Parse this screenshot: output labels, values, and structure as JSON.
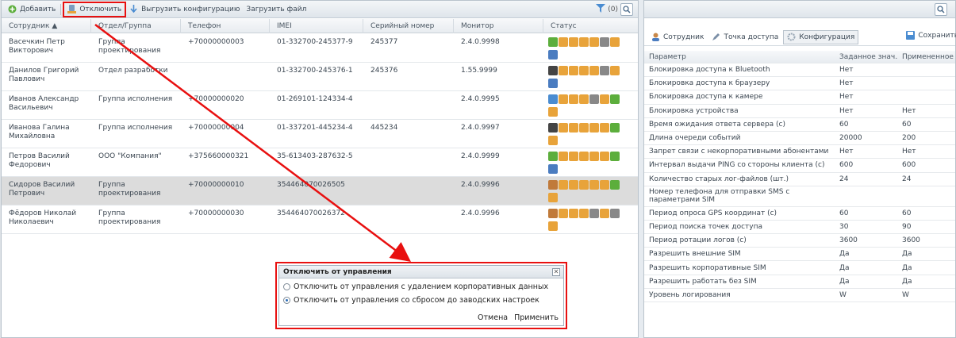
{
  "toolbar": {
    "add": "Добавить",
    "disconnect": "Отключить",
    "export": "Выгрузить конфигурацию",
    "upload": "Загрузить файл",
    "filter_count": "(0)"
  },
  "columns": [
    "Сотрудник ▲",
    "Отдел/Группа",
    "Телефон",
    "IMEI",
    "Серийный номер",
    "Монитор",
    "Статус"
  ],
  "rows": [
    {
      "name": "Васечкин Петр Викторович",
      "dept": "Группа проектирования",
      "phone": "+70000000003",
      "imei": "01-332700-245377-9",
      "serial": "245377",
      "monitor": "2.4.0.9998"
    },
    {
      "name": "Данилов Григорий Павлович",
      "dept": "Отдел разработки",
      "phone": "",
      "imei": "01-332700-245376-1",
      "serial": "245376",
      "monitor": "1.55.9999"
    },
    {
      "name": "Иванов Александр Васильевич",
      "dept": "Группа исполнения",
      "phone": "+70000000020",
      "imei": "01-269101-124334-4",
      "serial": "",
      "monitor": "2.4.0.9995"
    },
    {
      "name": "Иванова Галина Михайловна",
      "dept": "Группа исполнения",
      "phone": "+70000000004",
      "imei": "01-337201-445234-4",
      "serial": "445234",
      "monitor": "2.4.0.9997"
    },
    {
      "name": "Петров Василий Федорович",
      "dept": "ООО \"Компания\"",
      "phone": "+375660000321",
      "imei": "35-613403-287632-5",
      "serial": "",
      "monitor": "2.4.0.9999"
    },
    {
      "name": "Сидоров Василий Петрович",
      "dept": "Группа проектирования",
      "phone": "+70000000010",
      "imei": "354464070026505",
      "serial": "",
      "monitor": "2.4.0.9996"
    },
    {
      "name": "Фёдоров Николай Николаевич",
      "dept": "Группа проектирования",
      "phone": "+70000000030",
      "imei": "354464070026372",
      "serial": "",
      "monitor": "2.4.0.9996"
    }
  ],
  "dialog": {
    "title": "Отключить от управления",
    "option1": "Отключить от управления с удалением корпоративных данных",
    "option2": "Отключить от управления со сбросом до заводских настроек",
    "cancel": "Отмена",
    "apply": "Применить"
  },
  "right": {
    "tab_employee": "Сотрудник",
    "tab_access": "Точка доступа",
    "tab_config": "Конфигурация",
    "save": "Сохранить",
    "headers": [
      "Параметр",
      "Заданное знач...",
      "Примененное ..."
    ],
    "params": [
      [
        "Блокировка доступа к Bluetooth",
        "Нет",
        ""
      ],
      [
        "Блокировка доступа к браузеру",
        "Нет",
        ""
      ],
      [
        "Блокировка доступа к камере",
        "Нет",
        ""
      ],
      [
        "Блокировка устройства",
        "Нет",
        "Нет"
      ],
      [
        "Время ожидания ответа сервера (с)",
        "60",
        "60"
      ],
      [
        "Длина очереди событий",
        "20000",
        "200"
      ],
      [
        "Запрет связи с некорпоративными абонентами",
        "Нет",
        "Нет"
      ],
      [
        "Интервал выдачи PING со стороны клиента (с)",
        "600",
        "600"
      ],
      [
        "Количество старых лог-файлов (шт.)",
        "24",
        "24"
      ],
      [
        "Номер телефона для отправки SMS с параметрами SIM",
        "",
        ""
      ],
      [
        "Период опроса GPS координат (с)",
        "60",
        "60"
      ],
      [
        "Период поиска точек доступа",
        "30",
        "90"
      ],
      [
        "Период ротации логов (с)",
        "3600",
        "3600"
      ],
      [
        "Разрешить внешние SIM",
        "Да",
        "Да"
      ],
      [
        "Разрешить корпоративные SIM",
        "Да",
        "Да"
      ],
      [
        "Разрешить работать без SIM",
        "Да",
        "Да"
      ],
      [
        "Уровень логирования",
        "W",
        "W"
      ]
    ]
  },
  "colors": {
    "accent_red": "#e81010",
    "header_blue": "#2a6bb5"
  }
}
